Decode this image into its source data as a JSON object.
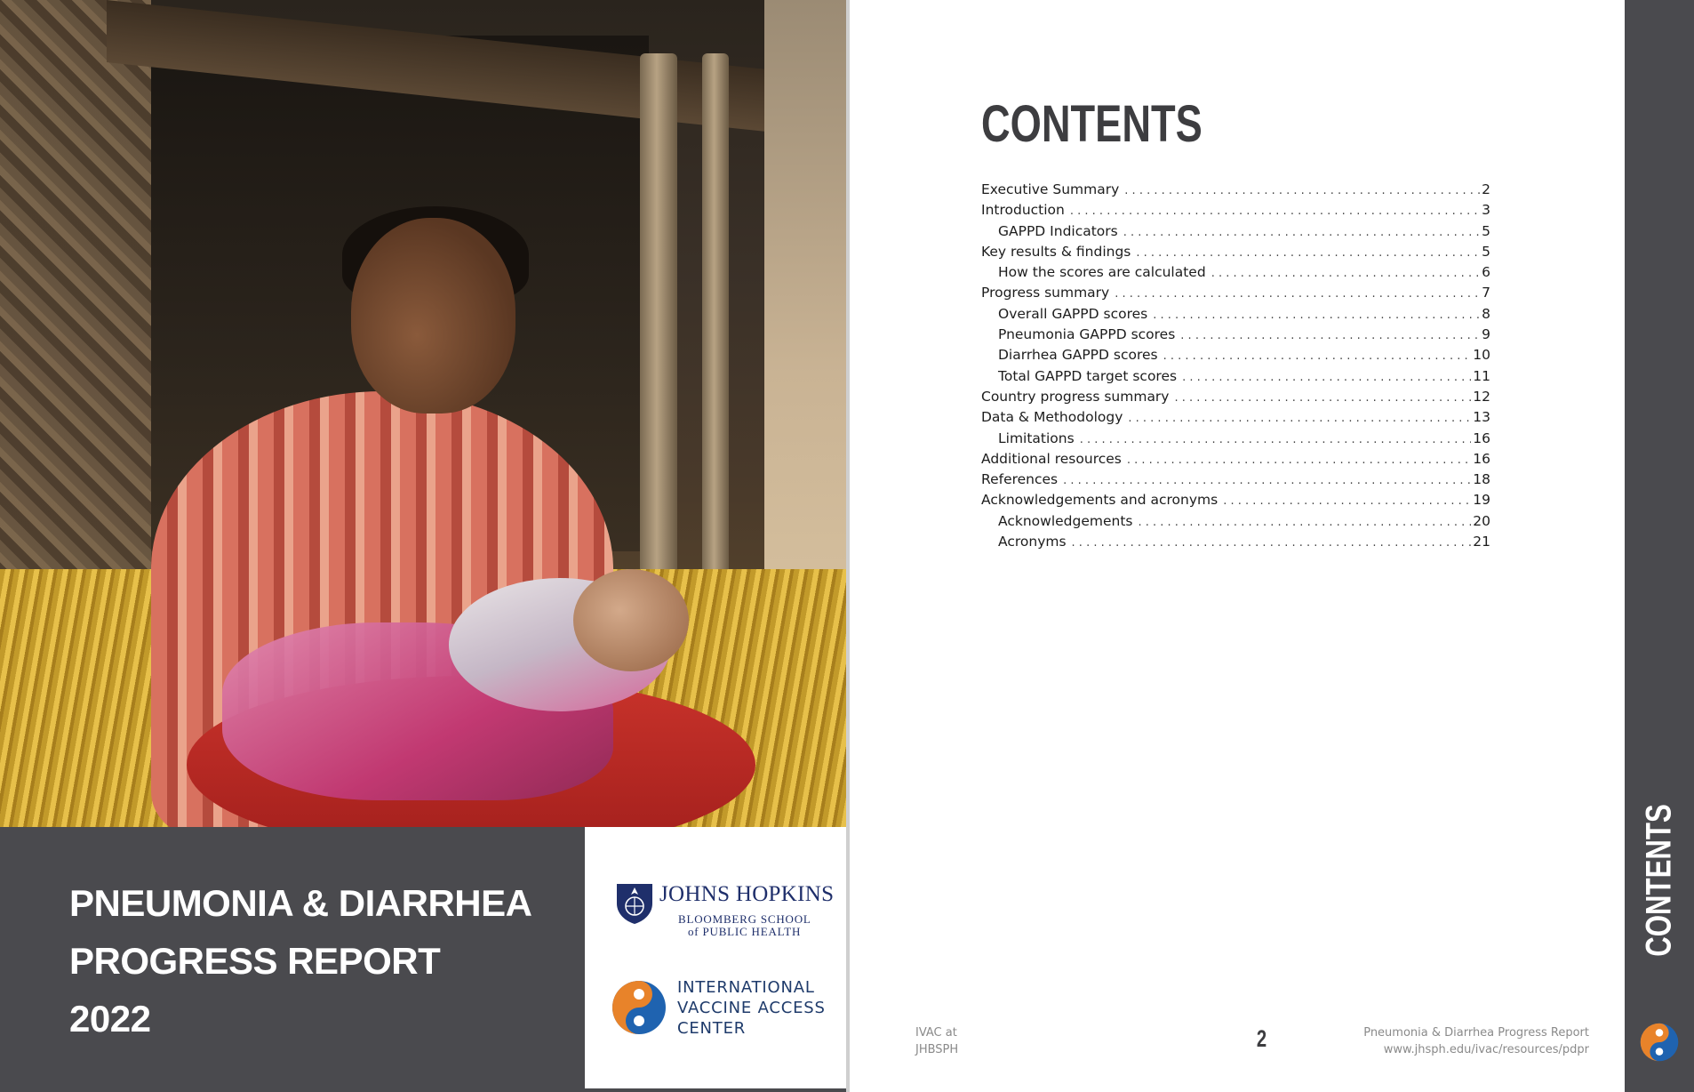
{
  "cover": {
    "title_lines": [
      "PNEUMONIA & DIARRHEA",
      "PROGRESS REPORT",
      "2022"
    ],
    "jh_logo": {
      "name": "JOHNS HOPKINS",
      "sub1": "BLOOMBERG SCHOOL",
      "sub2": "of PUBLIC HEALTH",
      "icon": "jh-shield-icon"
    },
    "ivac_logo": {
      "lines": [
        "INTERNATIONAL",
        "VACCINE ACCESS",
        "CENTER"
      ],
      "icon": "ivac-swirl-icon"
    },
    "colors": {
      "dark_panel": "#4a4a4e",
      "jh_blue": "#1f2f6b",
      "ivac_orange": "#e8832a",
      "ivac_blue": "#1f63b0"
    }
  },
  "contents": {
    "title": "CONTENTS",
    "items": [
      {
        "label": "Executive Summary",
        "page": "2",
        "sub": false
      },
      {
        "label": "Introduction",
        "page": "3",
        "sub": false
      },
      {
        "label": "GAPPD Indicators",
        "page": "5",
        "sub": true
      },
      {
        "label": "Key results & findings",
        "page": "5",
        "sub": false
      },
      {
        "label": "How the scores are calculated",
        "page": "6",
        "sub": true
      },
      {
        "label": "Progress summary",
        "page": "7",
        "sub": false
      },
      {
        "label": "Overall GAPPD scores",
        "page": "8",
        "sub": true
      },
      {
        "label": "Pneumonia GAPPD scores",
        "page": "9",
        "sub": true
      },
      {
        "label": "Diarrhea GAPPD scores",
        "page": "10",
        "sub": true
      },
      {
        "label": "Total GAPPD target scores",
        "page": "11",
        "sub": true
      },
      {
        "label": "Country progress summary",
        "page": "12",
        "sub": false
      },
      {
        "label": "Data & Methodology",
        "page": "13",
        "sub": false
      },
      {
        "label": "Limitations",
        "page": "16",
        "sub": true
      },
      {
        "label": "Additional resources",
        "page": "16",
        "sub": false
      },
      {
        "label": "References",
        "page": "18",
        "sub": false
      },
      {
        "label": "Acknowledgements and acronyms",
        "page": "19",
        "sub": false
      },
      {
        "label": "Acknowledgements",
        "page": "20",
        "sub": true
      },
      {
        "label": "Acronyms",
        "page": "21",
        "sub": true
      }
    ]
  },
  "footer": {
    "left_line1": "IVAC at",
    "left_line2": "JHBSPH",
    "page_number": "2",
    "right_line1": "Pneumonia & Diarrhea Progress Report",
    "right_line2": "www.jhsph.edu/ivac/resources/pdpr"
  },
  "side_tab": {
    "label": "CONTENTS",
    "icon": "ivac-swirl-icon"
  }
}
